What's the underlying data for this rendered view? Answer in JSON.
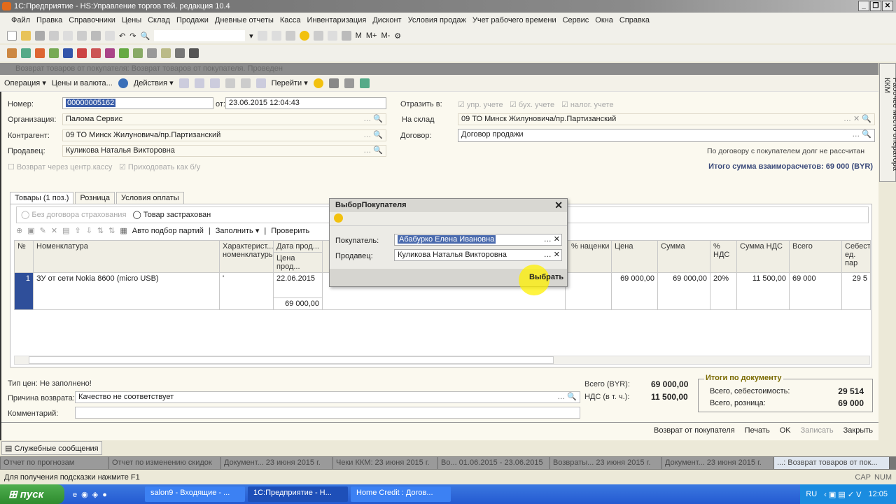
{
  "app": {
    "title": "1С:Предприятие - HS:Управление торгов тей. редакция 10.4"
  },
  "menu": [
    "Файл",
    "Правка",
    "Справочники",
    "Цены",
    "Склад",
    "Продажи",
    "Дневные отчеты",
    "Касса",
    "Инвентаризация",
    "Дисконт",
    "Условия продаж",
    "Учет рабочего времени",
    "Сервис",
    "Окна",
    "Справка"
  ],
  "toolbar": {
    "m": "М",
    "mplus": "М+",
    "mminus": "М-"
  },
  "doc": {
    "title": "Возврат товаров от покупателя: Возврат товаров от покупателя. Проведен",
    "toolbar": {
      "operation": "Операция ▾",
      "prices": "Цены и валюта...",
      "actions": "Действия ▾",
      "goto": "Перейти ▾"
    },
    "number_label": "Номер:",
    "number": "00000005162",
    "date_label": "от:",
    "date": "23.06.2015 12:04:43",
    "org_label": "Организация:",
    "org": "Палома Сервис",
    "contr_label": "Контрагент:",
    "contr": "09 ТО Минск Жилуновича/пр.Партизанский",
    "seller_label": "Продавец:",
    "seller": "Куликова Наталья Викторовна",
    "cb_central": "Возврат через центр.кассу",
    "cb_income": "Приходовать как б/у",
    "reflect_label": "Отразить в:",
    "reflect": [
      "упр. учете",
      "бух. учете",
      "налог. учете"
    ],
    "warehouse_label": "На склад",
    "warehouse": "09 ТО Минск Жилуновича/пр.Партизанский",
    "contract_label": "Договор:",
    "contract": "Договор продажи",
    "debt_note": "По договору с покупателем долг не рассчитан",
    "total_settle": "Итого сумма взаиморасчетов: 69 000 (BYR)",
    "tabs": [
      "Товары (1 поз.)",
      "Розница",
      "Условия оплаты"
    ],
    "insurance": [
      "Без договора страхования",
      "Товар застрахован"
    ],
    "table_toolbar": {
      "auto": "Авто подбор партий",
      "fill": "Заполнить ▾",
      "check": "Проверить"
    },
    "columns": {
      "num": "№",
      "item": "Номенклатура",
      "char": "Характерист...",
      "char2": "номенклатуры",
      "date": "Дата прод...",
      "price_sale": "Цена прод...",
      "markup": "% наценки",
      "price": "Цена",
      "sum": "Сумма",
      "vat_pct": "% НДС",
      "vat_sum": "Сумма НДС",
      "total": "Всего",
      "cost": "Себест ед. пар"
    },
    "rows": [
      {
        "num": "1",
        "item": "ЗУ от сети Nokia 8600 (micro USB)",
        "char": "'",
        "date": "22.06.2015",
        "price_sale": "69 000,00",
        "price": "69 000,00",
        "sum": "69 000,00",
        "vat_pct": "20%",
        "vat_sum": "11 500,00",
        "total": "69 000",
        "cost": "29 5"
      }
    ],
    "price_type": "Тип цен: Не заполнено!",
    "reason_label": "Причина возврата:",
    "reason": "Качество не соответствует",
    "comment_label": "Комментарий:",
    "total_label": "Всего (BYR):",
    "total": "69 000,00",
    "vat_label": "НДС (в т. ч.):",
    "vat": "11 500,00",
    "summary": {
      "title": "Итоги по документу",
      "cost_label": "Всего, себестоимость:",
      "cost": "29 514",
      "retail_label": "Всего, розница:",
      "retail": "69 000"
    },
    "buttons": [
      "Возврат от покупателя",
      "Печать",
      "OK",
      "Записать",
      "Закрыть"
    ]
  },
  "dialog": {
    "title": "ВыборПокупателя",
    "buyer_label": "Покупатель:",
    "buyer": "Абабурко Елена Ивановна",
    "seller_label": "Продавец:",
    "seller": "Куликова Наталья Викторовна",
    "select": "Выбрать"
  },
  "side_panel": "Рабочее место оператора ККМ",
  "service_msgs": "Служебные сообщения",
  "window_tabs": [
    "Отчет по прогнозам",
    "Отчет по изменению скидок",
    "Документ... 23 июня 2015 г.",
    "Чеки ККМ: 23 июня 2015 г.",
    "Во... 01.06.2015 - 23.06.2015",
    "Возвраты... 23 июня 2015 г.",
    "Документ... 23 июня 2015 г.",
    "...: Возврат товаров от пок..."
  ],
  "status": {
    "hint": "Для получения подсказки нажмите F1",
    "cap": "CAP",
    "num": "NUM"
  },
  "taskbar": {
    "start": "пуск",
    "items": [
      "salon9 - Входящие - ...",
      "1С:Предприятие - Н...",
      "Home Credit : Догов..."
    ],
    "lang": "RU",
    "clock": "12:05"
  }
}
